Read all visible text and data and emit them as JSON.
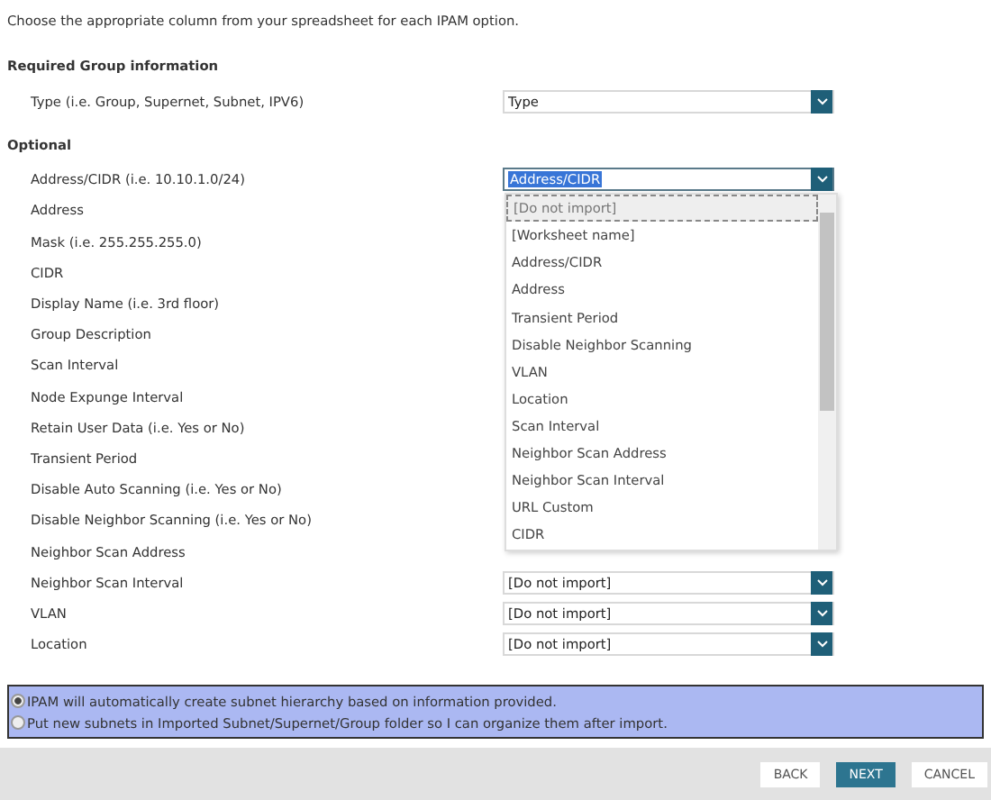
{
  "intro": "Choose the appropriate column from your spreadsheet for each IPAM option.",
  "required": {
    "heading": "Required Group information",
    "fields": [
      {
        "label": "Type (i.e. Group, Supernet, Subnet, IPV6)",
        "value": "Type"
      }
    ]
  },
  "optional": {
    "heading": "Optional",
    "fields": [
      {
        "label": "Address/CIDR (i.e. 10.10.1.0/24)",
        "value": "Address/CIDR",
        "open": true
      },
      {
        "label": "Address"
      },
      {
        "label": "Mask (i.e. 255.255.255.0)"
      },
      {
        "label": "CIDR"
      },
      {
        "label": "Display Name (i.e. 3rd floor)"
      },
      {
        "label": "Group Description"
      },
      {
        "label": "Scan Interval"
      },
      {
        "label": "Node Expunge Interval"
      },
      {
        "label": "Retain User Data (i.e. Yes or No)"
      },
      {
        "label": "Transient Period"
      },
      {
        "label": "Disable Auto Scanning (i.e. Yes or No)"
      },
      {
        "label": "Disable Neighbor Scanning (i.e. Yes or No)"
      },
      {
        "label": "Neighbor Scan Address"
      },
      {
        "label": "Neighbor Scan Interval",
        "value": "[Do not import]"
      },
      {
        "label": "VLAN",
        "value": "[Do not import]"
      },
      {
        "label": "Location",
        "value": "[Do not import]"
      }
    ]
  },
  "dropdown": {
    "options": [
      {
        "label": "[Do not import]",
        "selected": true
      },
      {
        "label": "[Worksheet name]",
        "selected": false
      },
      {
        "label": "Address/CIDR",
        "selected": false
      },
      {
        "label": "Address",
        "selected": false
      },
      {
        "label": "Transient Period",
        "selected": false
      },
      {
        "label": "Disable Neighbor Scanning",
        "selected": false
      },
      {
        "label": "VLAN",
        "selected": false
      },
      {
        "label": "Location",
        "selected": false
      },
      {
        "label": "Scan Interval",
        "selected": false
      },
      {
        "label": "Neighbor Scan Address",
        "selected": false
      },
      {
        "label": "Neighbor Scan Interval",
        "selected": false
      },
      {
        "label": "URL Custom",
        "selected": false
      },
      {
        "label": "CIDR",
        "selected": false
      }
    ]
  },
  "hierarchy_options": [
    {
      "label": "IPAM will automatically create subnet hierarchy based on information provided.",
      "selected": true
    },
    {
      "label": "Put new subnets in Imported Subnet/Supernet/Group folder so I can organize them after import.",
      "selected": false
    }
  ],
  "buttons": [
    {
      "label": "BACK",
      "kind": "secondary"
    },
    {
      "label": "NEXT",
      "kind": "primary"
    },
    {
      "label": "CANCEL",
      "kind": "secondary"
    }
  ]
}
